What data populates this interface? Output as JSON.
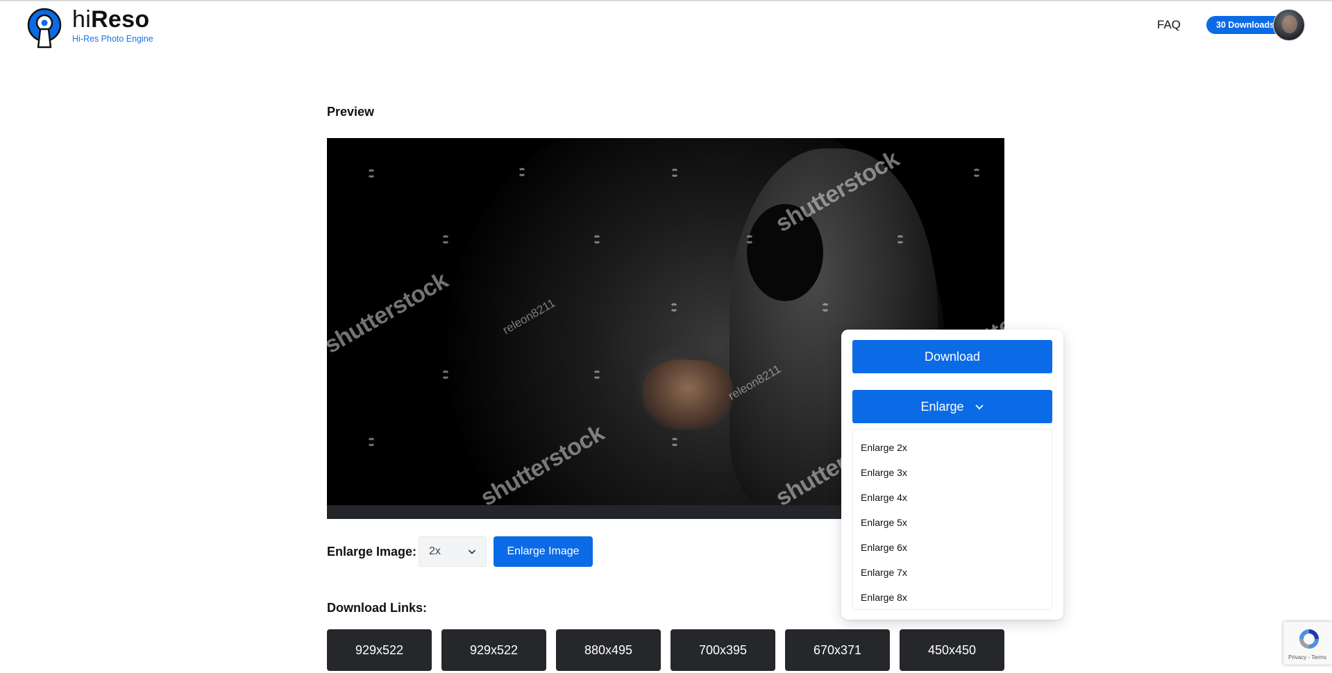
{
  "header": {
    "brand_prefix": "hi",
    "brand_suffix": "Reso",
    "tagline": "Hi-Res Photo Engine",
    "faq_label": "FAQ",
    "downloads_badge": "30 Downloads"
  },
  "preview": {
    "title": "Preview",
    "watermarks": {
      "brand": "shutterstock",
      "contributor": "releon8211"
    }
  },
  "enlarge": {
    "label": "Enlarge Image:",
    "selected": "2x",
    "button_label": "Enlarge Image"
  },
  "download_links": {
    "title": "Download Links:",
    "sizes": [
      "929x522",
      "929x522",
      "880x495",
      "700x395",
      "670x371",
      "450x450"
    ]
  },
  "panel": {
    "download_label": "Download",
    "enlarge_label": "Enlarge",
    "menu": [
      "Enlarge 2x",
      "Enlarge 3x",
      "Enlarge 4x",
      "Enlarge 5x",
      "Enlarge 6x",
      "Enlarge 7x",
      "Enlarge 8x"
    ]
  },
  "recaptcha": {
    "text": "Privacy - Terms"
  },
  "colors": {
    "accent": "#0b6be6",
    "dark_button": "#25272b",
    "brand_tagline": "#1a73e8"
  },
  "icons": {
    "logo": "keyhole-logo-icon",
    "select_chevron": "chevron-down-icon",
    "panel_chevron": "chevron-down-icon",
    "recaptcha": "recaptcha-icon"
  }
}
